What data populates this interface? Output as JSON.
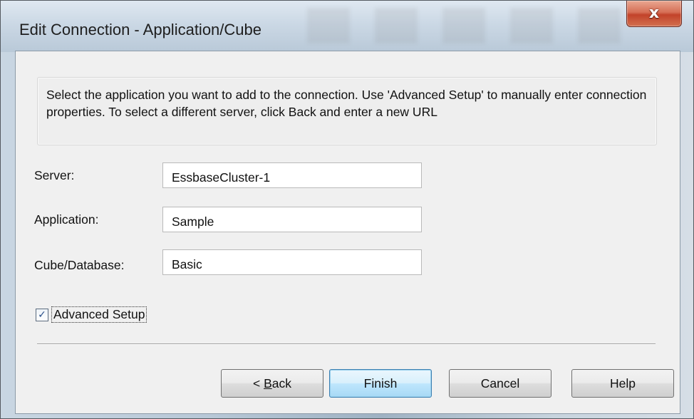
{
  "window": {
    "title": "Edit Connection - Application/Cube",
    "close_glyph": "x"
  },
  "description": "Select the application you want to add to the connection. Use 'Advanced Setup' to manually enter connection properties. To select a different server, click Back and enter a new URL",
  "form": {
    "server": {
      "label": "Server:",
      "value": "EssbaseCluster-1"
    },
    "application": {
      "label": "Application:",
      "value": "Sample"
    },
    "cube": {
      "label": "Cube/Database:",
      "value": "Basic"
    }
  },
  "advanced_setup": {
    "label": "Advanced Setup",
    "checked": true,
    "check_glyph": "✓"
  },
  "buttons": {
    "back_prefix": "< ",
    "back_mnemonic": "B",
    "back_rest": "ack",
    "finish": "Finish",
    "cancel": "Cancel",
    "help": "Help"
  },
  "colors": {
    "close_button": "#c2432a",
    "default_button_border": "#3c7fb1",
    "dialog_background": "#f0f0f0"
  }
}
